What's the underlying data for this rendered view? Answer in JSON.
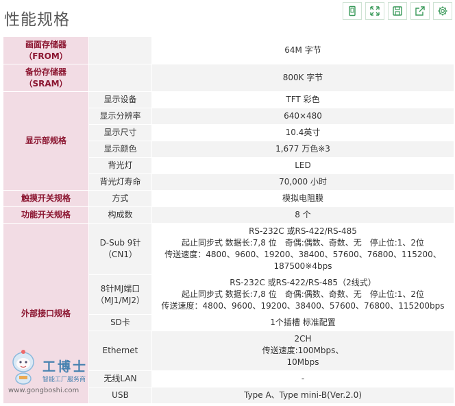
{
  "page": {
    "title": "性能规格"
  },
  "toolbar": {
    "buttons": [
      {
        "icon": "mobile-icon"
      },
      {
        "icon": "expand-icon"
      },
      {
        "icon": "save-icon"
      },
      {
        "icon": "share-icon"
      },
      {
        "icon": "gear-icon"
      }
    ]
  },
  "table": {
    "frame_memory": {
      "label": "画面存储器\n（FROM）",
      "value": "64M 字节"
    },
    "backup_memory": {
      "label": "备份存储器\n（SRAM）",
      "value": "800K 字节"
    },
    "display": {
      "label": "显示部规格",
      "rows": [
        {
          "name": "显示设备",
          "value": "TFT 彩色"
        },
        {
          "name": "显示分辨率",
          "value": "640×480"
        },
        {
          "name": "显示尺寸",
          "value": "10.4英寸"
        },
        {
          "name": "显示颜色",
          "value": "1,677 万色※3"
        },
        {
          "name": "背光灯",
          "value": "LED"
        },
        {
          "name": "背光灯寿命",
          "value": "70,000 小时"
        }
      ]
    },
    "touch": {
      "label": "触摸开关规格",
      "name": "方式",
      "value": "模拟电阻膜"
    },
    "func": {
      "label": "功能开关规格",
      "name": "构成数",
      "value": "8 个"
    },
    "external": {
      "label": "外部接口规格",
      "rows": [
        {
          "name": "D-Sub 9针\n（CN1）",
          "value": "RS-232C 或RS-422/RS-485\n起止同步式 数据长:7,8 位　奇偶:偶数、奇数、无　停止位:1、2位\n传送速度：4800、9600、19200、38400、57600、76800、115200、\n187500※4bps"
        },
        {
          "name": "8针MJ端口\n（MJ1/MJ2）",
          "value": "RS-232C 或RS-422/RS-485（2线式）\n起止同步式 数据长:7,8 位　奇偶:偶数、奇数、无　停止位:1、2位\n传送速度：4800、9600、19200、38400、57600、76800、115200bps"
        },
        {
          "name": "SD卡",
          "value": "1个插槽 标准配置"
        },
        {
          "name": "Ethernet",
          "value": "2CH\n传送速度:100Mbps、\n10Mbps"
        },
        {
          "name": "无线LAN",
          "value": "-"
        },
        {
          "name": "USB",
          "value": "Type A、Type mini-B(Ver.2.0)"
        }
      ]
    }
  },
  "watermark": {
    "name": "工博士",
    "sub": "智能工厂服务商",
    "url": "www.gongboshi.com"
  },
  "colors": {
    "category_bg": "#f2dce4",
    "category_text": "#8b1530",
    "sub_bg": "#f3f3f3",
    "toolbar_icon": "#3a9a5a"
  }
}
